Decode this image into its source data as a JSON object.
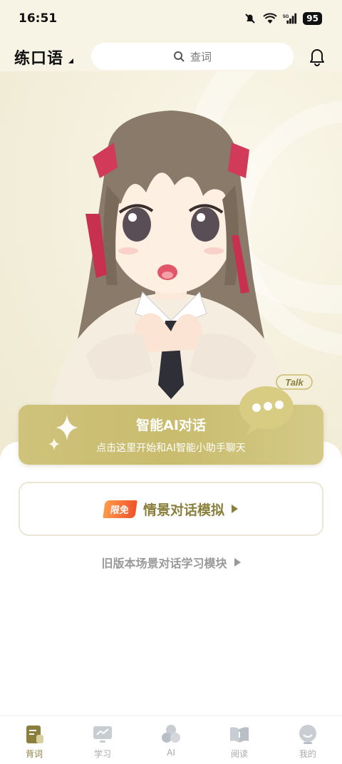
{
  "status": {
    "time": "16:51",
    "battery": "95",
    "icons": [
      "mute-bell-icon",
      "wifi-icon",
      "5g-signal-icon"
    ]
  },
  "header": {
    "title": "练口语",
    "search_placeholder": "查词",
    "icons": [
      "search-icon",
      "bell-icon"
    ]
  },
  "hero": {
    "talk_tag": "Talk",
    "ai_title": "智能AI对话",
    "ai_subtitle": "点击这里开始和AI智能小助手聊天"
  },
  "scene_card": {
    "badge": "限免",
    "label": "情景对话模拟"
  },
  "legacy_link": "旧版本场景对话学习模块",
  "bottom_nav": {
    "items": [
      {
        "label": "背词",
        "icon": "book-icon",
        "active": true
      },
      {
        "label": "学习",
        "icon": "monitor-chart-icon",
        "active": false
      },
      {
        "label": "AI",
        "icon": "ai-cluster-icon",
        "active": false
      },
      {
        "label": "阅读",
        "icon": "open-book-icon",
        "active": false
      },
      {
        "label": "我的",
        "icon": "profile-icon",
        "active": false
      }
    ]
  },
  "colors": {
    "accent": "#8a7f3c",
    "banner": "#cfc27a",
    "badge": "#f0532a"
  }
}
